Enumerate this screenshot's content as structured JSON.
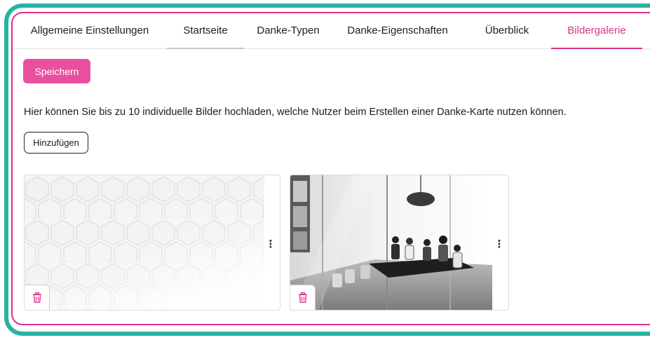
{
  "tabs": [
    {
      "label": "Allgemeine Einstellungen"
    },
    {
      "label": "Startseite"
    },
    {
      "label": "Danke-Typen"
    },
    {
      "label": "Danke-Eigenschaften"
    },
    {
      "label": "Überblick"
    },
    {
      "label": "Bildergalerie"
    }
  ],
  "actions": {
    "save_label": "Speichern",
    "add_label": "Hinzufügen"
  },
  "gallery": {
    "description": "Hier können Sie bis zu 10 individuelle Bilder hochladen, welche Nutzer beim Erstellen einer Danke-Karte nutzen können.",
    "images": [
      {
        "content": "white hexagon pattern",
        "menu_icon": "kebab-menu-icon",
        "delete_icon": "trash-icon"
      },
      {
        "content": "black-and-white office meeting room with people at a conference table",
        "menu_icon": "kebab-menu-icon",
        "delete_icon": "trash-icon"
      }
    ]
  },
  "colors": {
    "accent": "#d9328c",
    "button": "#ea4f9e",
    "frame": "#27b3a3"
  }
}
